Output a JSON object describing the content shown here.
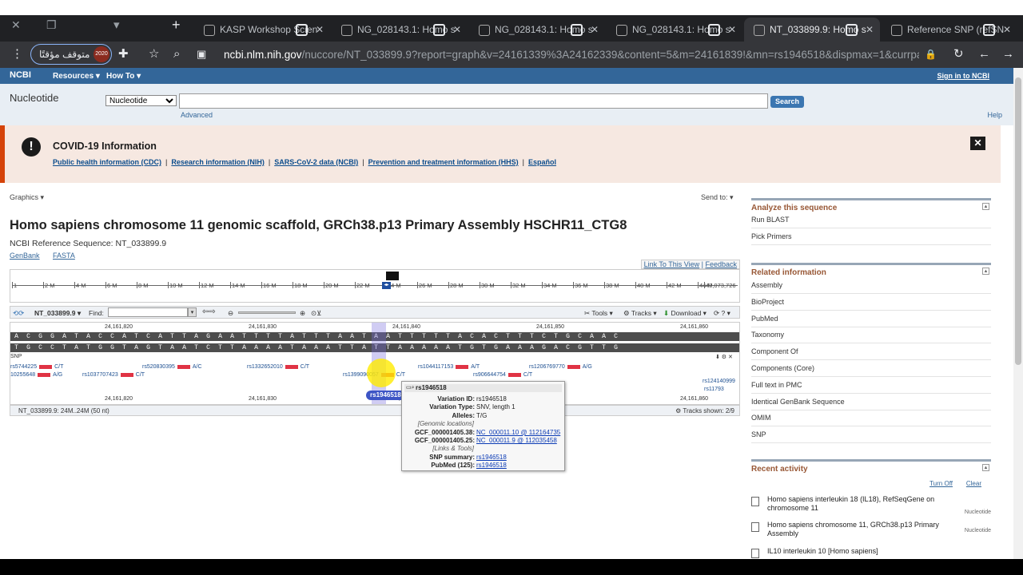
{
  "browser": {
    "tabs": [
      {
        "label": "KASP Workshop Scien"
      },
      {
        "label": "NG_028143.1: Homo s"
      },
      {
        "label": "NG_028143.1: Homo s"
      },
      {
        "label": "NG_028143.1: Homo s"
      },
      {
        "label": "NT_033899.9: Homo s",
        "active": true
      },
      {
        "label": "Reference SNP (refSN"
      }
    ],
    "profile_label": "متوقف مؤقتًا",
    "url_domain": "ncbi.nlm.nih.gov",
    "url_path": "/nuccore/NT_033899.9?report=graph&v=24161339%3A24162339&content=5&m=24161839!&mn=rs1946518&dispmax=1&currpa..."
  },
  "ncbi": {
    "logo": "NCBI",
    "resources": "Resources",
    "howto": "How To",
    "signin": "Sign in to NCBI",
    "db_name": "Nucleotide",
    "db_select": "Nucleotide",
    "search_btn": "Search",
    "advanced": "Advanced",
    "help": "Help"
  },
  "covid": {
    "title": "COVID-19 Information",
    "links": [
      "Public health information (CDC)",
      "Research information (NIH)",
      "SARS-CoV-2 data (NCBI)",
      "Prevention and treatment information (HHS)",
      "Español"
    ]
  },
  "record": {
    "graphics": "Graphics",
    "send_to": "Send to:",
    "title": "Homo sapiens chromosome 11 genomic scaffold, GRCh38.p13 Primary Assembly HSCHR11_CTG8",
    "refseq": "NCBI Reference Sequence: NT_033899.9",
    "genbank": "GenBank",
    "fasta": "FASTA"
  },
  "viewer": {
    "link_view": "Link To This View",
    "feedback": "Feedback",
    "ruler_ticks": [
      "1",
      "2 M",
      "4 M",
      "6 M",
      "8 M",
      "10 M",
      "12 M",
      "14 M",
      "16 M",
      "18 M",
      "20 M",
      "22 M",
      "24 M",
      "26 M",
      "28 M",
      "30 M",
      "32 M",
      "34 M",
      "36 M",
      "38 M",
      "40 M",
      "42 M",
      "44 M",
      "47,073,726"
    ],
    "seqid": "NT_033899.9",
    "find": "Find:",
    "tools": "Tools",
    "tracks": "Tracks",
    "download": "Download",
    "positions_top": [
      "24,161,820",
      "24,161,830",
      "24,161,840",
      "24,161,850",
      "24,161,860"
    ],
    "positions_bottom": [
      "24,161,820",
      "24,161,830",
      "24,161,840",
      "24,161,850",
      "24,161,860"
    ],
    "seq_top": "ACGGATACCATCATTAGAATTTTATTTAATAATTTTTACACTTTCTGCAAC",
    "seq_bot": "TGCCTATGGTAGTAATCTTAAAATAAATTATTAAAAATGTGAAAGACGTTG",
    "snp_track": "SNP",
    "snp_selected": "rs1946518",
    "snps": [
      {
        "id": "rs5744225",
        "alleles": "C/T"
      },
      {
        "id": "rs520830395",
        "alleles": "A/C"
      },
      {
        "id": "rs1332652010",
        "alleles": "C/T"
      },
      {
        "id": "rs1044117153",
        "alleles": "A/T"
      },
      {
        "id": "rs1206769770",
        "alleles": "A/G"
      },
      {
        "id": "10255648",
        "alleles": "A/G"
      },
      {
        "id": "rs1037707423",
        "alleles": "C/T"
      },
      {
        "id": "rs1399090057",
        "alleles": "C/T"
      },
      {
        "id": "rs906644754",
        "alleles": "C/T"
      },
      {
        "id": "rs124140999",
        "alleles": ""
      },
      {
        "id": "rs11793",
        "alleles": ""
      }
    ],
    "status_left": "NT_033899.9: 24M..24M (50 nt)",
    "status_right": "Tracks shown: 2/9"
  },
  "tooltip": {
    "title": "rs1946518",
    "rows": [
      {
        "k": "Variation ID:",
        "v": "rs1946518",
        "link": false
      },
      {
        "k": "Variation Type:",
        "v": "SNV, length 1",
        "link": false
      },
      {
        "k": "Alleles:",
        "v": "T/G",
        "link": false
      },
      {
        "sec": "[Genomic locations]"
      },
      {
        "k": "GCF_000001405.38:",
        "v": "NC_000011.10 @ 112164735",
        "link": true
      },
      {
        "k": "GCF_000001405.25:",
        "v": "NC_000011.9 @ 112035458",
        "link": true
      },
      {
        "sec": "[Links & Tools]"
      },
      {
        "k": "SNP summary:",
        "v": "rs1946518",
        "link": true
      },
      {
        "k": "PubMed (125):",
        "v": "rs1946518",
        "link": true
      }
    ]
  },
  "sidebar": {
    "analyze_title": "Analyze this sequence",
    "analyze_items": [
      "Run BLAST",
      "Pick Primers"
    ],
    "related_title": "Related information",
    "related_items": [
      "Assembly",
      "BioProject",
      "PubMed",
      "Taxonomy",
      "Component Of",
      "Components (Core)",
      "Full text in PMC",
      "Identical GenBank Sequence",
      "OMIM",
      "SNP"
    ],
    "recent_title": "Recent activity",
    "turn_off": "Turn Off",
    "clear": "Clear",
    "recent": [
      {
        "text": "Homo sapiens interleukin 18 (IL18), RefSeqGene on chromosome 11",
        "src": "Nucleotide"
      },
      {
        "text": "Homo sapiens chromosome 11, GRCh38.p13 Primary Assembly",
        "src": "Nucleotide"
      },
      {
        "text": "IL10 interleukin 10 [Homo sapiens]",
        "src": ""
      }
    ]
  }
}
